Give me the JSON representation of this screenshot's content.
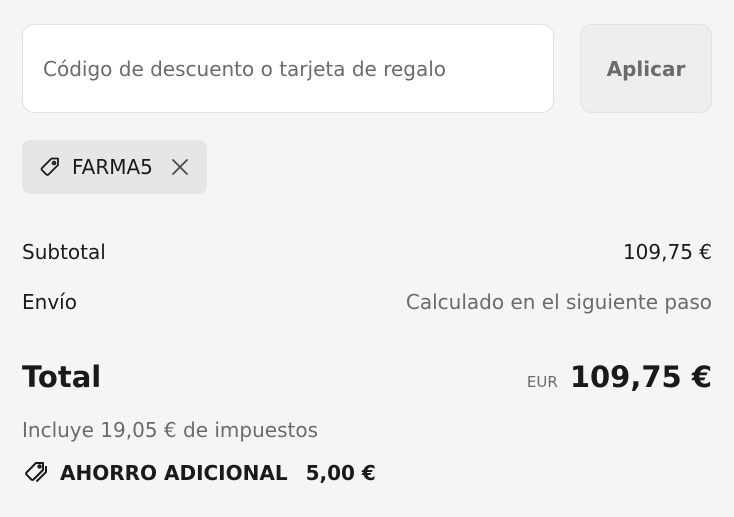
{
  "discount": {
    "placeholder": "Código de descuento o tarjeta de regalo",
    "apply_label": "Aplicar"
  },
  "applied_code": {
    "code": "FARMA5",
    "tag_icon": "tag-icon",
    "remove_icon": "close-icon"
  },
  "summary": {
    "subtotal_label": "Subtotal",
    "subtotal_value": "109,75 €",
    "shipping_label": "Envío",
    "shipping_value": "Calculado en el siguiente paso",
    "total_label": "Total",
    "currency_code": "EUR",
    "total_value": "109,75 €",
    "taxes_note": "Incluye 19,05 € de impuestos",
    "savings_icon": "tags-icon",
    "savings_label": "AHORRO ADICIONAL",
    "savings_value": "5,00 €"
  },
  "colors": {
    "background": "#f5f5f5",
    "muted_text": "#6b6b6b",
    "chip_background": "#e6e6e6"
  }
}
